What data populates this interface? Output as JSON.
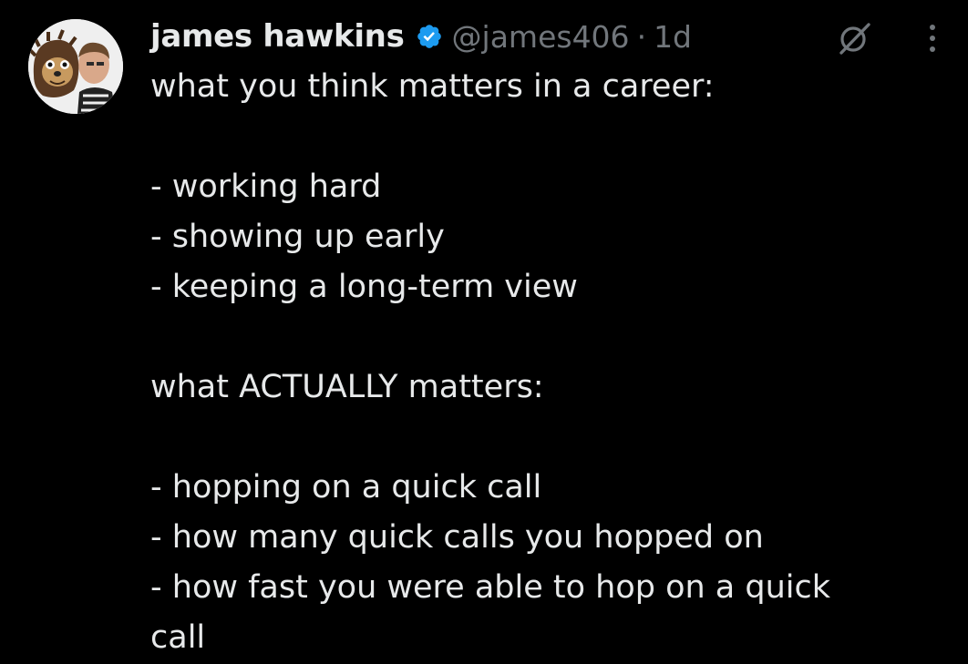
{
  "author": {
    "display_name": "james hawkins",
    "handle": "@james406",
    "separator": "·",
    "time": "1d"
  },
  "icons": {
    "avatar": "avatar-photo",
    "verified": "verified-badge-icon",
    "grok": "grok-icon",
    "more": "more-options-icon"
  },
  "colors": {
    "background": "#000000",
    "text_primary": "#e7e9ea",
    "text_secondary": "#71767b",
    "verified_blue": "#1d9bf0"
  },
  "tweet": {
    "lines": [
      "what you think matters in a career:",
      "",
      "- working hard",
      "- showing up early",
      "- keeping a long-term view",
      "",
      "what ACTUALLY matters:",
      "",
      "- hopping on a quick call",
      "- how many quick calls you hopped on",
      "- how fast you were able to hop on a quick",
      "call"
    ]
  }
}
